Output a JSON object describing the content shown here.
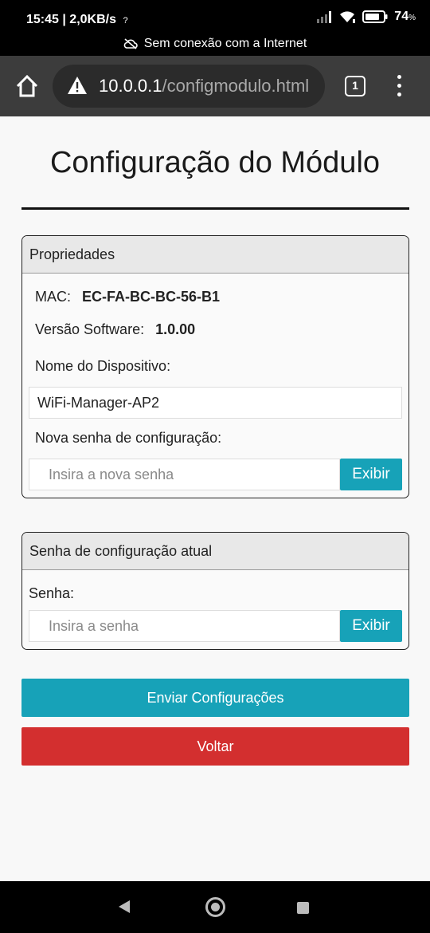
{
  "status_bar": {
    "time": "15:45",
    "speed": "| 2,0KB/s",
    "battery_percent": "74",
    "battery_unit": "%",
    "offline_message": "Sem conexão com a Internet"
  },
  "browser": {
    "url_host": "10.0.0.1",
    "url_path": "/configmodulo.html",
    "tab_count": "1"
  },
  "page": {
    "title": "Configuração do Módulo"
  },
  "properties_card": {
    "header": "Propriedades",
    "mac_label": "MAC:",
    "mac_value": "EC-FA-BC-BC-56-B1",
    "software_label": "Versão Software:",
    "software_value": "1.0.00",
    "device_name_label": "Nome do Dispositivo:",
    "device_name_value": "WiFi-Manager-AP2",
    "new_password_label": "Nova senha de configuração:",
    "new_password_placeholder": "Insira a nova senha",
    "show_button": "Exibir"
  },
  "current_password_card": {
    "header": "Senha de configuração atual",
    "password_label": "Senha:",
    "password_placeholder": "Insira a senha",
    "show_button": "Exibir"
  },
  "actions": {
    "send_button": "Enviar Configurações",
    "back_button": "Voltar"
  },
  "colors": {
    "primary": "#17a2b8",
    "danger": "#d32f2f",
    "toolbar": "#3c3c3c"
  }
}
